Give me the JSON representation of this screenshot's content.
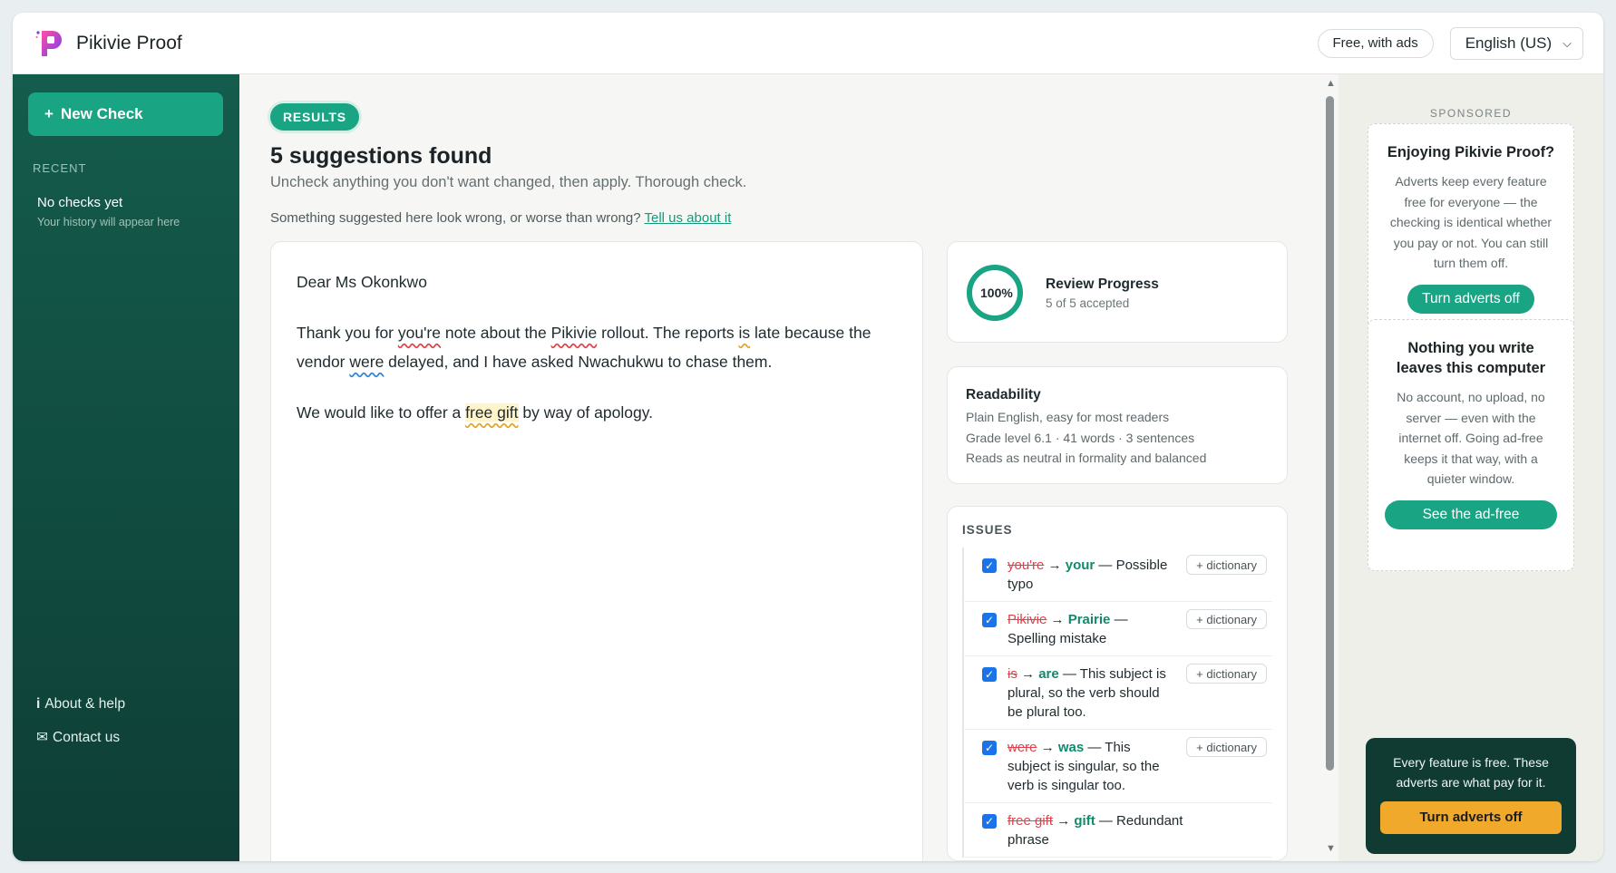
{
  "header": {
    "title": "Pikivie Proof",
    "plan_badge": "Free, with ads",
    "language": "English (US)"
  },
  "sidebar": {
    "new_check_label": "New Check",
    "recent_heading": "RECENT",
    "empty_title": "No checks yet",
    "empty_note": "Your history will appear here",
    "about_label": "About & help",
    "contact_label": "Contact us"
  },
  "results": {
    "badge": "RESULTS",
    "title": "5 suggestions found",
    "subtitle": "Uncheck anything you don't want changed, then apply. Thorough check.",
    "feedback_text": "Something suggested here look wrong, or worse than wrong?",
    "feedback_link": "Tell us about it"
  },
  "document": {
    "salutation": "Dear Ms Okonkwo",
    "p1": [
      "Thank you for ",
      "you're",
      " note about the ",
      "Pikivie",
      " rollout. The reports ",
      "is",
      " late because the vendor ",
      "were",
      " delayed, and I have asked Nwachukwu to chase them."
    ],
    "p2": [
      "We would like to offer a ",
      "free gift",
      " by way of apology."
    ]
  },
  "progress": {
    "percent": "100%",
    "title": "Review Progress",
    "detail": "5 of 5 accepted",
    "fraction": 1.0
  },
  "readability": {
    "title": "Readability",
    "lines": [
      "Plain English, easy for most readers",
      "Grade level 6.1 · 41 words · 3 sentences",
      "Reads as neutral in formality and balanced"
    ]
  },
  "issues": {
    "heading": "ISSUES",
    "dictionary_label": "+ dictionary",
    "items": [
      {
        "original": "you're",
        "replacement": "your",
        "reason": "— Possible typo",
        "has_dictionary": true,
        "checked": true
      },
      {
        "original": "Pikivie",
        "replacement": "Prairie",
        "reason": "— Spelling mistake",
        "has_dictionary": true,
        "checked": true
      },
      {
        "original": "is",
        "replacement": "are",
        "reason": "— This subject is plural, so the verb should be plural too.",
        "has_dictionary": true,
        "checked": true
      },
      {
        "original": "were",
        "replacement": "was",
        "reason": "— This subject is singular, so the verb is singular too.",
        "has_dictionary": true,
        "checked": true
      },
      {
        "original": "free gift",
        "replacement": "gift",
        "reason": "— Redundant phrase",
        "has_dictionary": false,
        "checked": true
      }
    ]
  },
  "ads": {
    "sponsored": "SPONSORED",
    "card1": {
      "title": "Enjoying Pikivie Proof?",
      "body": "Adverts keep every feature free for everyone — the checking is identical whether you pay or not. You can still turn them off.",
      "button": "Turn adverts off"
    },
    "card2": {
      "title": "Nothing you write leaves this computer",
      "body": "No account, no upload, no server — even with the internet off. Going ad-free keeps it that way, with a quieter window.",
      "button": "See the ad-free version"
    },
    "promo": {
      "text": "Every feature is free. These adverts are what pay for it.",
      "button": "Turn adverts off"
    }
  },
  "colors": {
    "accent": "#19a483",
    "sidebar": "#0e3e36",
    "error": "#e0414a",
    "grammar": "#2b84d9",
    "style": "#e0a426",
    "promo_button": "#f0a92a"
  }
}
